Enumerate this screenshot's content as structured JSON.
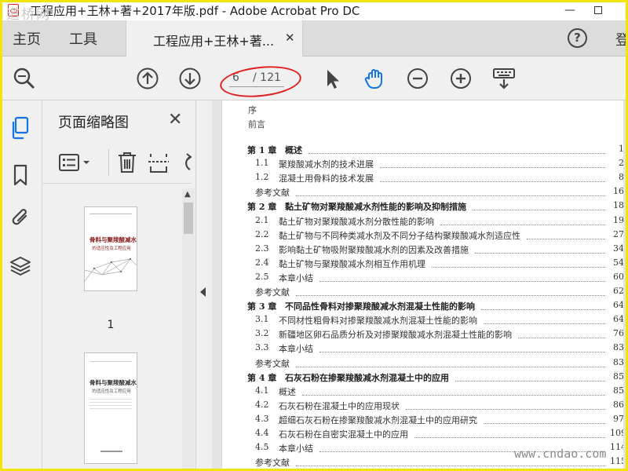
{
  "titlebar": {
    "title": "工程应用+王林+著+2017年版.pdf - Adobe Acrobat Pro DC",
    "watermark_logo": "道桥网",
    "minimize": "—"
  },
  "tabs": {
    "home": "主页",
    "tools": "工具",
    "doc_tab": "工程应用+王林+著...",
    "close": "✕",
    "help": "?",
    "signin": "登"
  },
  "toolbar": {
    "page_current": "6",
    "page_total": "/ 121",
    "icons": [
      "zoom-search-icon",
      "prev-page-icon",
      "next-page-icon",
      "select-arrow-icon",
      "hand-icon",
      "zoom-out-icon",
      "zoom-in-icon",
      "keyboard-shortcut-icon"
    ]
  },
  "panel": {
    "title": "页面缩略图",
    "close": "✕",
    "thumb1_number": "1",
    "cover_title": "骨料与聚羧酸减水剂",
    "cover_subtitle": "的适应性及工程应用",
    "scroll_up": "▲"
  },
  "toc": {
    "preface": "序",
    "foreword": "前言",
    "entries": [
      {
        "num": "第 1 章",
        "title": "概述",
        "page": "1",
        "chapter": true
      },
      {
        "num": "1.1",
        "title": "聚羧酸减水剂的技术进展",
        "page": "2",
        "chapter": false
      },
      {
        "num": "1.2",
        "title": "混凝土用骨料的技术发展",
        "page": "8",
        "chapter": false
      },
      {
        "num": "",
        "title": "参考文献",
        "page": "16",
        "chapter": false
      },
      {
        "num": "第 2 章",
        "title": "黏土矿物对聚羧酸减水剂性能的影响及抑制措施",
        "page": "18",
        "chapter": true
      },
      {
        "num": "2.1",
        "title": "黏土矿物对聚羧酸减水剂分散性能的影响",
        "page": "19",
        "chapter": false
      },
      {
        "num": "2.2",
        "title": "黏土矿物与不同种类减水剂及不同分子结构聚羧酸减水剂适应性",
        "page": "27",
        "chapter": false
      },
      {
        "num": "2.3",
        "title": "影响黏土矿物吸附聚羧酸减水剂的因素及改善措施",
        "page": "34",
        "chapter": false
      },
      {
        "num": "2.4",
        "title": "黏土矿物与聚羧酸减水剂相互作用机理",
        "page": "54",
        "chapter": false
      },
      {
        "num": "2.5",
        "title": "本章小结",
        "page": "60",
        "chapter": false
      },
      {
        "num": "",
        "title": "参考文献",
        "page": "62",
        "chapter": false
      },
      {
        "num": "第 3 章",
        "title": "不同品性骨料对掺聚羧酸减水剂混凝土性能的影响",
        "page": "64",
        "chapter": true
      },
      {
        "num": "3.1",
        "title": "不同材性粗骨料对掺聚羧酸减水剂混凝土性能的影响",
        "page": "64",
        "chapter": false
      },
      {
        "num": "3.2",
        "title": "新疆地区卵石品质分析及对掺聚羧酸减水剂混凝土性能的影响",
        "page": "76",
        "chapter": false
      },
      {
        "num": "3.3",
        "title": "本章小结",
        "page": "83",
        "chapter": false
      },
      {
        "num": "",
        "title": "参考文献",
        "page": "83",
        "chapter": false
      },
      {
        "num": "第 4 章",
        "title": "石灰石粉在掺聚羧酸减水剂混凝土中的应用",
        "page": "85",
        "chapter": true
      },
      {
        "num": "4.1",
        "title": "概述",
        "page": "85",
        "chapter": false
      },
      {
        "num": "4.2",
        "title": "石灰石粉在混凝土中的应用现状",
        "page": "86",
        "chapter": false
      },
      {
        "num": "4.3",
        "title": "超细石灰石粉在掺聚羧酸减水剂混凝土中的应用研究",
        "page": "97",
        "chapter": false
      },
      {
        "num": "4.4",
        "title": "石灰石粉在自密实混凝土中的应用",
        "page": "109",
        "chapter": false
      },
      {
        "num": "4.5",
        "title": "本章小结",
        "page": "114",
        "chapter": false
      },
      {
        "num": "",
        "title": "参考文献",
        "page": "115",
        "chapter": false
      }
    ]
  },
  "site_watermark": "www.cndao.com"
}
